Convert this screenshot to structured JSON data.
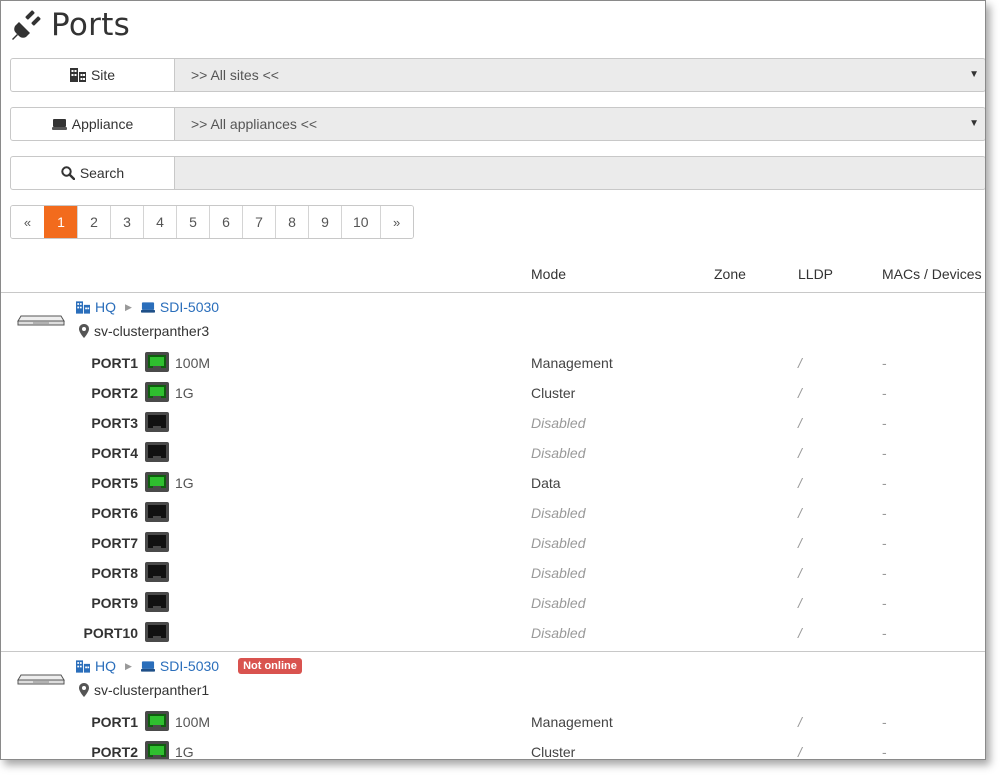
{
  "page": {
    "title": "Ports"
  },
  "filters": {
    "site": {
      "label": "Site",
      "value": ">> All sites <<"
    },
    "appliance": {
      "label": "Appliance",
      "value": ">> All appliances <<"
    },
    "search": {
      "label": "Search",
      "value": "",
      "placeholder": ""
    }
  },
  "pagination": {
    "prev": "«",
    "next": "»",
    "pages": [
      "1",
      "2",
      "3",
      "4",
      "5",
      "6",
      "7",
      "8",
      "9",
      "10"
    ],
    "active": "1"
  },
  "table": {
    "columns": [
      "Mode",
      "Zone",
      "LLDP",
      "MACs / Devices"
    ]
  },
  "devices": [
    {
      "site": "HQ",
      "appliance": "SDI-5030",
      "location": "sv-clusterpanther3",
      "status": "",
      "ports": [
        {
          "name": "PORT1",
          "up": true,
          "speed": "100M",
          "mode": "Management",
          "disabled": false,
          "lldp": "/",
          "macs": "-"
        },
        {
          "name": "PORT2",
          "up": true,
          "speed": "1G",
          "mode": "Cluster",
          "disabled": false,
          "lldp": "/",
          "macs": "-"
        },
        {
          "name": "PORT3",
          "up": false,
          "speed": "",
          "mode": "Disabled",
          "disabled": true,
          "lldp": "/",
          "macs": "-"
        },
        {
          "name": "PORT4",
          "up": false,
          "speed": "",
          "mode": "Disabled",
          "disabled": true,
          "lldp": "/",
          "macs": "-"
        },
        {
          "name": "PORT5",
          "up": true,
          "speed": "1G",
          "mode": "Data",
          "disabled": false,
          "lldp": "/",
          "macs": "-"
        },
        {
          "name": "PORT6",
          "up": false,
          "speed": "",
          "mode": "Disabled",
          "disabled": true,
          "lldp": "/",
          "macs": "-"
        },
        {
          "name": "PORT7",
          "up": false,
          "speed": "",
          "mode": "Disabled",
          "disabled": true,
          "lldp": "/",
          "macs": "-"
        },
        {
          "name": "PORT8",
          "up": false,
          "speed": "",
          "mode": "Disabled",
          "disabled": true,
          "lldp": "/",
          "macs": "-"
        },
        {
          "name": "PORT9",
          "up": false,
          "speed": "",
          "mode": "Disabled",
          "disabled": true,
          "lldp": "/",
          "macs": "-"
        },
        {
          "name": "PORT10",
          "up": false,
          "speed": "",
          "mode": "Disabled",
          "disabled": true,
          "lldp": "/",
          "macs": "-"
        }
      ]
    },
    {
      "site": "HQ",
      "appliance": "SDI-5030",
      "location": "sv-clusterpanther1",
      "status": "Not online",
      "ports": [
        {
          "name": "PORT1",
          "up": true,
          "speed": "100M",
          "mode": "Management",
          "disabled": false,
          "lldp": "/",
          "macs": "-"
        },
        {
          "name": "PORT2",
          "up": true,
          "speed": "1G",
          "mode": "Cluster",
          "disabled": false,
          "lldp": "/",
          "macs": "-"
        }
      ]
    }
  ],
  "colors": {
    "accent": "#f26b1d",
    "link": "#2a6ebb",
    "danger": "#d9534f",
    "port_up": "#2fbf2f"
  }
}
